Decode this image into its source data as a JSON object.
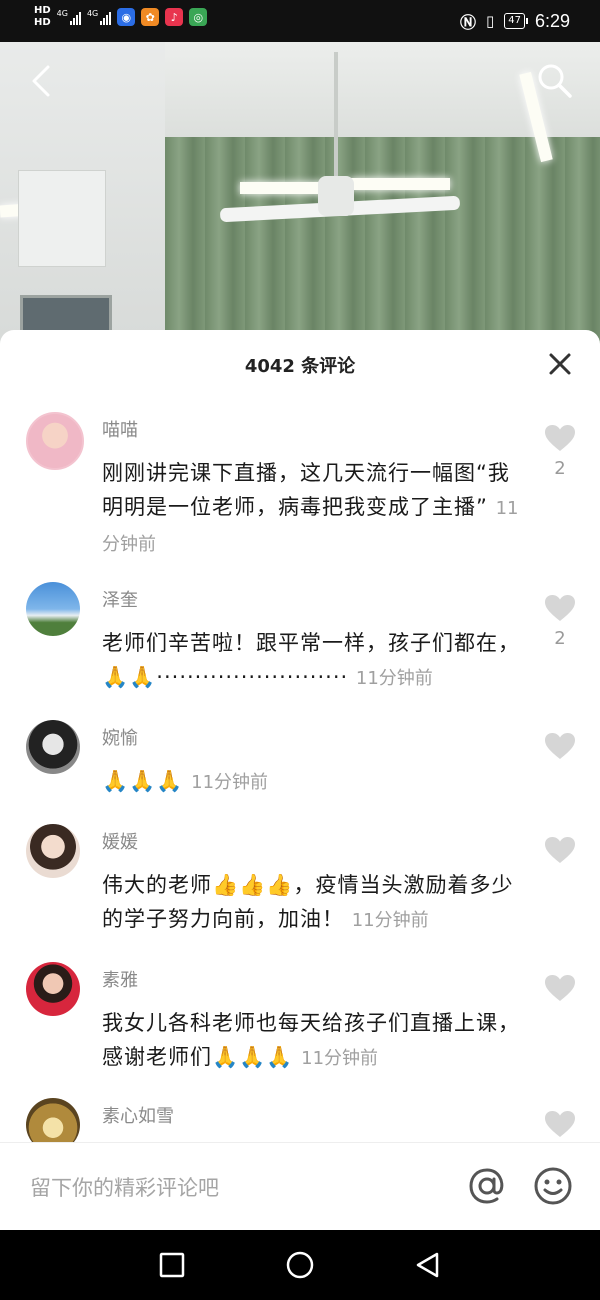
{
  "status_bar": {
    "network_top": "HD",
    "network_bottom": "HD",
    "signal1_tag": "4G",
    "signal2_tag": "4G",
    "battery": "47",
    "time": "6:29",
    "apps": [
      {
        "icon": "baidu-app-icon",
        "glyph": "◉",
        "color": "#2b6de5"
      },
      {
        "icon": "weibo-app-icon",
        "glyph": "✿",
        "color": "#f08a24"
      },
      {
        "icon": "douyin-app-icon",
        "glyph": "♪",
        "color": "#e8344e"
      },
      {
        "icon": "browser-app-icon",
        "glyph": "◎",
        "color": "#3aa655"
      }
    ]
  },
  "comments_panel": {
    "title": "4042 条评论",
    "comments": [
      {
        "name": "喵喵",
        "text": "刚刚讲完课下直播，这几天流行一幅图“我明明是一位老师，病毒把我变成了主播”",
        "time": "11分钟前",
        "likes": "2",
        "avatar_color": "#f0b8c6"
      },
      {
        "name": "泽奎",
        "text": "老师们辛苦啦！跟平常一样，孩子们都在，🙏🙏·························",
        "time": "11分钟前",
        "likes": "2",
        "avatar_color": "#3f7fc4"
      },
      {
        "name": "婉愉",
        "text": "🙏🙏🙏",
        "time": "11分钟前",
        "likes": "",
        "avatar_color": "#555555"
      },
      {
        "name": "媛媛",
        "text": "伟大的老师👍👍👍，疫情当头激励着多少的学子努力向前，加油！",
        "time": "11分钟前",
        "likes": "",
        "avatar_color": "#e9c9b5"
      },
      {
        "name": "素雅",
        "text": "我女儿各科老师也每天给孩子们直播上课，感谢老师们🙏🙏🙏",
        "time": "11分钟前",
        "likes": "",
        "avatar_color": "#d7263d"
      },
      {
        "name": "素心如雪",
        "text": "",
        "time": "",
        "likes": "",
        "avatar_color": "#b08a3c"
      }
    ]
  },
  "input": {
    "placeholder": "留下你的精彩评论吧"
  },
  "icons": {
    "back": "back-arrow-icon",
    "search": "search-icon",
    "close": "close-icon",
    "like": "heart-icon",
    "mention": "at-icon",
    "emoji": "emoji-icon",
    "nav_recent": "square-icon",
    "nav_home": "circle-icon",
    "nav_back": "triangle-back-icon"
  },
  "colors": {
    "like_gray": "#d6d6d6",
    "text_primary": "#1a1a1a",
    "text_secondary": "#8a8a8a"
  }
}
